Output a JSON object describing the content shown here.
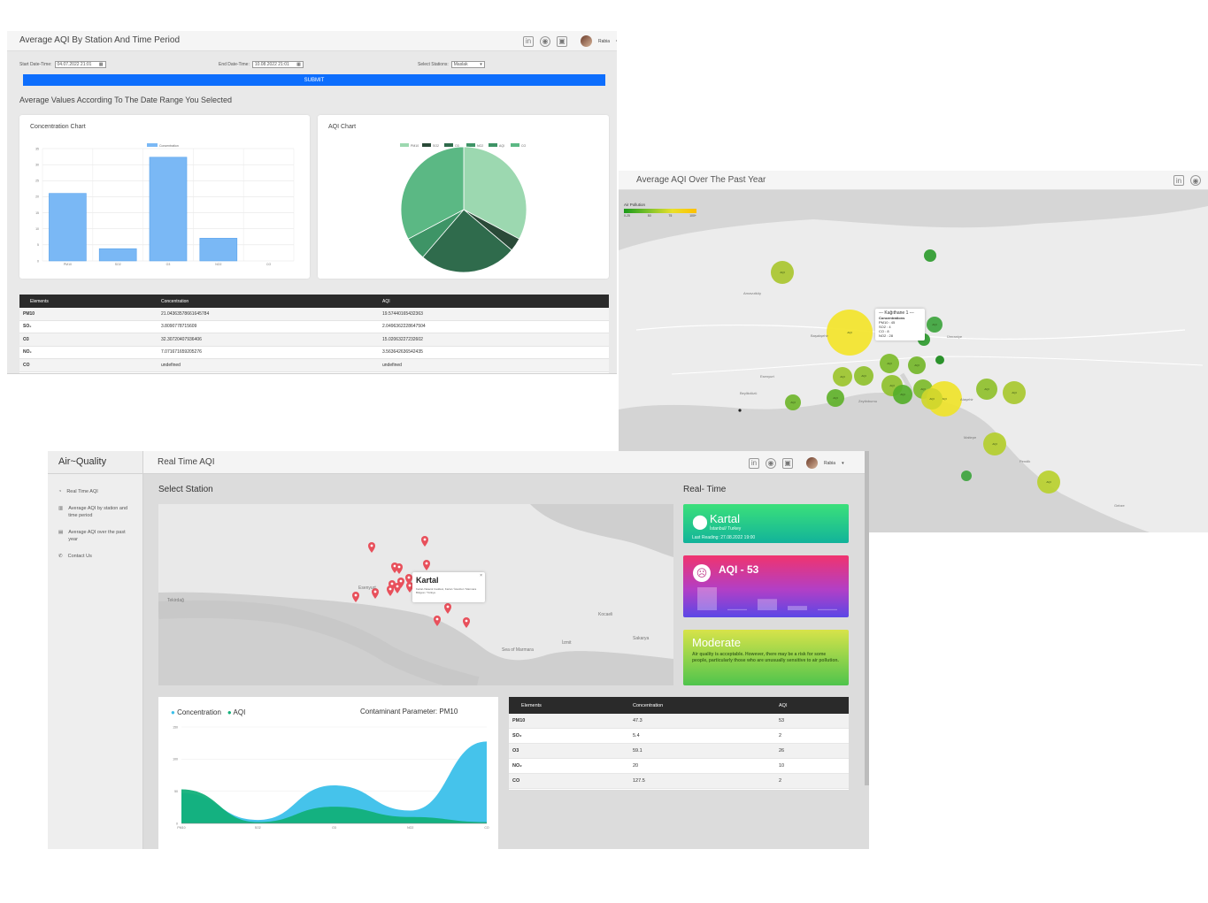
{
  "screen1": {
    "title": "Average AQI By Station And Time Period",
    "user": "Rabia",
    "icons": [
      "linkedin-icon",
      "github-icon",
      "teams-icon"
    ],
    "start_label": "Start Date-Time:",
    "start_value": "04.07.2022 21:01",
    "end_label": "End Date-Time:",
    "end_value": "10.08.2022 21:01",
    "station_label": "Select Stations:",
    "station_value": "Maslak",
    "submit_label": "SUBMIT",
    "subtitle": "Average Values According To The Date Range You Selected",
    "concentration_card_title": "Concentration Chart",
    "aqi_card_title": "AQI Chart",
    "table": {
      "headers": [
        "Elements",
        "Concentration",
        "AQI"
      ],
      "rows": [
        [
          "PM10",
          "21.04363578661645784",
          "19.57440165432363"
        ],
        [
          "SO₂",
          "3.8090778715609",
          "2.0496362228647504"
        ],
        [
          "O3",
          "32.30720407936406",
          "15.02063227232602"
        ],
        [
          "NO₂",
          "7.071671659205276",
          "3.563642636542435"
        ],
        [
          "CO",
          "undefined",
          "undefined"
        ]
      ]
    }
  },
  "screen2": {
    "title": "Average AQI Over The Past Year",
    "legend_title": "Air Pollution",
    "legend_ticks": [
      "0-25",
      "50",
      "75",
      "100+"
    ],
    "popup": {
      "title": "--- Kağıthane 1 ---",
      "subtitle": "Concentrations",
      "lines": [
        "PM10 : 45",
        "SO2 : 4",
        "CO : 8",
        "NO2 : 28"
      ]
    },
    "places": [
      "Arnavutköy",
      "Başakşehir",
      "Esenyurt",
      "Beylikdüzü",
      "Zeytinburnu",
      "Ümraniye",
      "Ataşehir",
      "Maltepe",
      "Pendik",
      "Gebze"
    ],
    "bubble_label": "AQI"
  },
  "screen3": {
    "brand": "Air~Quality",
    "title": "Real Time AQI",
    "user": "Rabia",
    "sidebar": [
      {
        "label": "Real Time AQI",
        "icon": "dashboard-icon"
      },
      {
        "label": "Average AQI by station and time period",
        "icon": "bar-chart-icon"
      },
      {
        "label": "Average AQI over the past year",
        "icon": "map-icon"
      },
      {
        "label": "Contact Us",
        "icon": "phone-icon"
      }
    ],
    "select_station_title": "Select Station",
    "realtime_title": "Real- Time",
    "map_popup": {
      "title": "Kartal",
      "subtitle": "Kartal-Yakacık Caddesi, Kartal / İstanbul / Marmara Bölgesi / Türkiye"
    },
    "map_places": [
      "Tekirdağ",
      "Esenyurt",
      "Kocaeli",
      "Sakarya",
      "Sea of Marmara",
      "İzmit"
    ],
    "location_card": {
      "name": "Kartal",
      "region": "İstanbul/ Turkey",
      "last_reading": "Last Reading: 27.08.2022 19:00"
    },
    "aqi_card": {
      "label": "AQI - 53"
    },
    "status_card": {
      "status": "Moderate",
      "description": "Air quality is acceptable. However, there may be a risk for some people, particularly those who are unusually sensitive to air pollution."
    },
    "chart_legend": [
      "Concentration",
      "AQI"
    ],
    "contaminant_label": "Contaminant Parameter: PM10",
    "table": {
      "headers": [
        "Elements",
        "Concentration",
        "AQI"
      ],
      "rows": [
        [
          "PM10",
          "47.3",
          "53"
        ],
        [
          "SO₂",
          "5.4",
          "2"
        ],
        [
          "O3",
          "59.1",
          "26"
        ],
        [
          "NO₂",
          "20",
          "10"
        ],
        [
          "CO",
          "127.5",
          "2"
        ]
      ]
    }
  },
  "chart_data": [
    {
      "type": "bar",
      "title": "Concentration Chart",
      "legend": [
        "Concentration"
      ],
      "categories": [
        "PM10",
        "SO2",
        "O3",
        "NO2",
        "CO"
      ],
      "values": [
        21.04,
        3.81,
        32.31,
        7.07,
        0
      ],
      "ylim": [
        0,
        35
      ],
      "yticks": [
        0,
        5,
        10,
        15,
        20,
        25,
        30,
        35
      ],
      "color": "#7ab8f5"
    },
    {
      "type": "pie",
      "title": "AQI Chart",
      "legend": [
        "PM10",
        "SO2",
        "O3",
        "NO2",
        "AQI",
        "CO"
      ],
      "slices": [
        {
          "name": "PM10",
          "value": 19.57,
          "color": "#9cd8b0"
        },
        {
          "name": "SO2",
          "value": 2.05,
          "color": "#2a4a38"
        },
        {
          "name": "O3",
          "value": 15.02,
          "color": "#2f6b4c"
        },
        {
          "name": "NO2",
          "value": 3.56,
          "color": "#3e9466"
        },
        {
          "name": "CO",
          "value": 19.57,
          "color": "#5bb884"
        }
      ]
    },
    {
      "type": "area",
      "legend": [
        "Concentration",
        "AQI"
      ],
      "categories": [
        "PM10",
        "SO2",
        "O3",
        "NO2",
        "CO"
      ],
      "series": [
        {
          "name": "Concentration",
          "values": [
            47.3,
            5.4,
            59.1,
            20,
            127.5
          ],
          "color": "#3bc0ea"
        },
        {
          "name": "AQI",
          "values": [
            53,
            2,
            26,
            10,
            2
          ],
          "color": "#12b07a"
        }
      ],
      "ylim": [
        0,
        150
      ],
      "yticks": [
        0,
        50,
        100,
        150
      ]
    }
  ]
}
